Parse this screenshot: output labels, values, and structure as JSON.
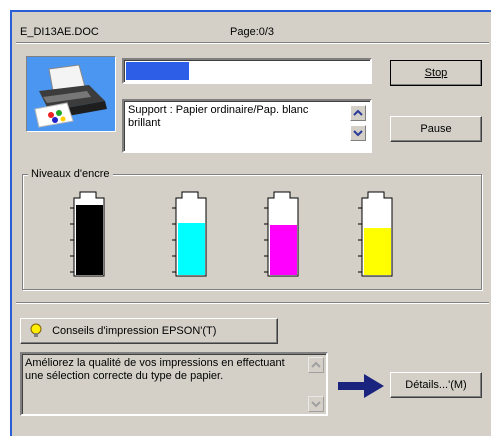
{
  "job": {
    "filename": "E_DI13AE.DOC",
    "page_status": "Page:0/3",
    "progress_fraction": 0.26
  },
  "media": {
    "text": "Support : Papier ordinaire/Pap. blanc brillant"
  },
  "buttons": {
    "stop": "Stop",
    "pause": "Pause",
    "tips": "Conseils d'impression EPSON'(T)",
    "details": "Détails...'(M)"
  },
  "ink": {
    "group_label": "Niveaux d'encre",
    "cartridges": [
      {
        "name": "black-ink-cartridge",
        "color": "#000000",
        "level": 0.92
      },
      {
        "name": "cyan-ink-cartridge",
        "color": "#00ffff",
        "level": 0.68
      },
      {
        "name": "magenta-ink-cartridge",
        "color": "#ff00ff",
        "level": 0.66
      },
      {
        "name": "yellow-ink-cartridge",
        "color": "#ffff00",
        "level": 0.62
      }
    ]
  },
  "tip": {
    "text": "Améliorez la qualité de vos impressions en effectuant une sélection correcte du type de papier."
  },
  "colors": {
    "progress": "#2c5ee8",
    "frame": "#2a5ed4",
    "arrow": "#1a237e"
  }
}
